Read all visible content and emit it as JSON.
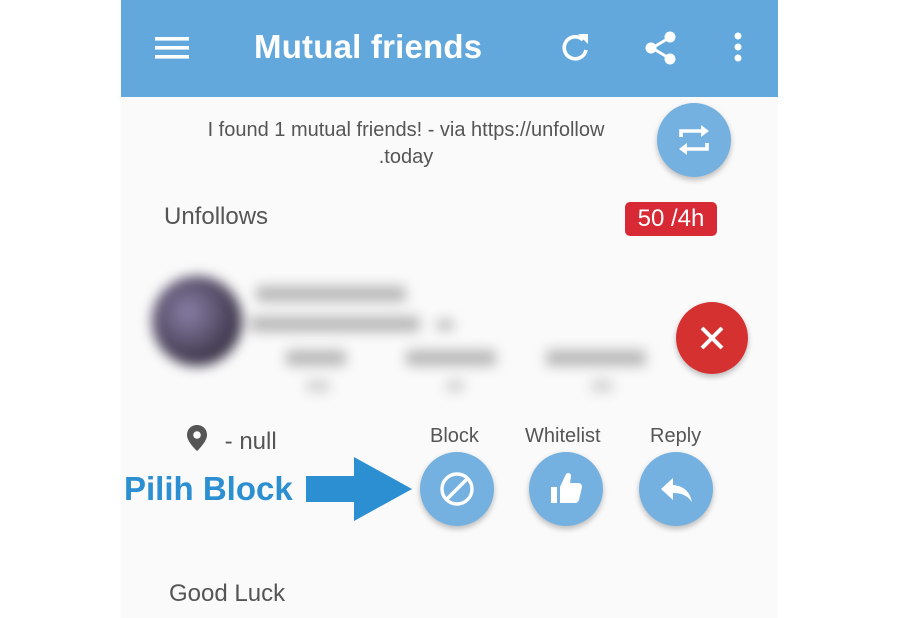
{
  "appbar": {
    "title": "Mutual friends",
    "icons": [
      "menu-icon",
      "refresh-icon",
      "share-icon",
      "more-vert-icon"
    ],
    "color": "#62a8dd"
  },
  "info": {
    "line1": "I found 1 mutual friends! -  via https://unfollow",
    "line2": ".today"
  },
  "unfollows": {
    "label": "Unfollows",
    "badge": "50 /4h",
    "badge_color": "#d82a35"
  },
  "profile": {
    "location": "- null"
  },
  "actions": {
    "block_label": "Block",
    "whitelist_label": "Whitelist",
    "reply_label": "Reply",
    "button_color": "#74b1e0"
  },
  "footer": {
    "text": "Good Luck"
  },
  "annotation": {
    "text": "Pilih Block",
    "color": "#2b8fd1"
  }
}
